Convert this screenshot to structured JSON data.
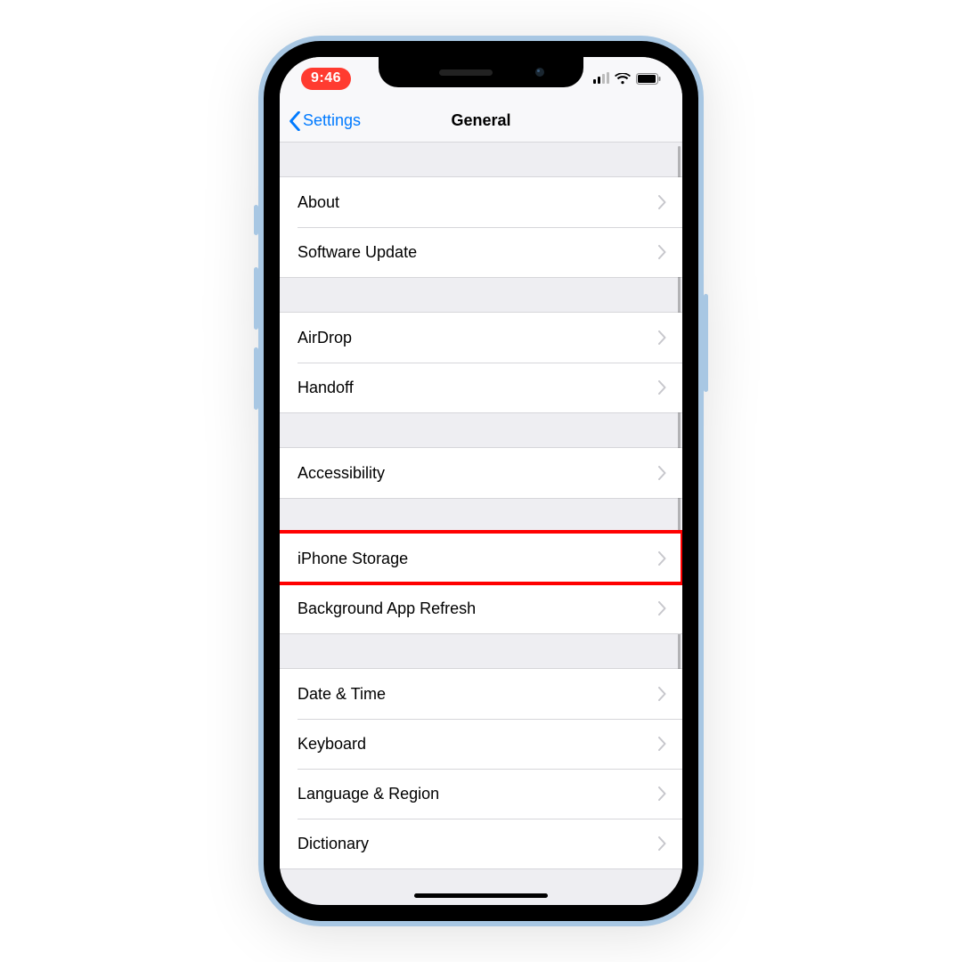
{
  "status": {
    "time": "9:46"
  },
  "nav": {
    "back_label": "Settings",
    "title": "General"
  },
  "sections": [
    {
      "items": [
        {
          "label": "About"
        },
        {
          "label": "Software Update"
        }
      ]
    },
    {
      "items": [
        {
          "label": "AirDrop"
        },
        {
          "label": "Handoff"
        }
      ]
    },
    {
      "items": [
        {
          "label": "Accessibility"
        }
      ]
    },
    {
      "items": [
        {
          "label": "iPhone Storage",
          "highlighted": true
        },
        {
          "label": "Background App Refresh"
        }
      ]
    },
    {
      "items": [
        {
          "label": "Date & Time"
        },
        {
          "label": "Keyboard"
        },
        {
          "label": "Language & Region"
        },
        {
          "label": "Dictionary"
        }
      ]
    }
  ],
  "colors": {
    "accent": "#007aff",
    "highlight": "#ff0000",
    "recording_pill": "#ff3b30"
  }
}
